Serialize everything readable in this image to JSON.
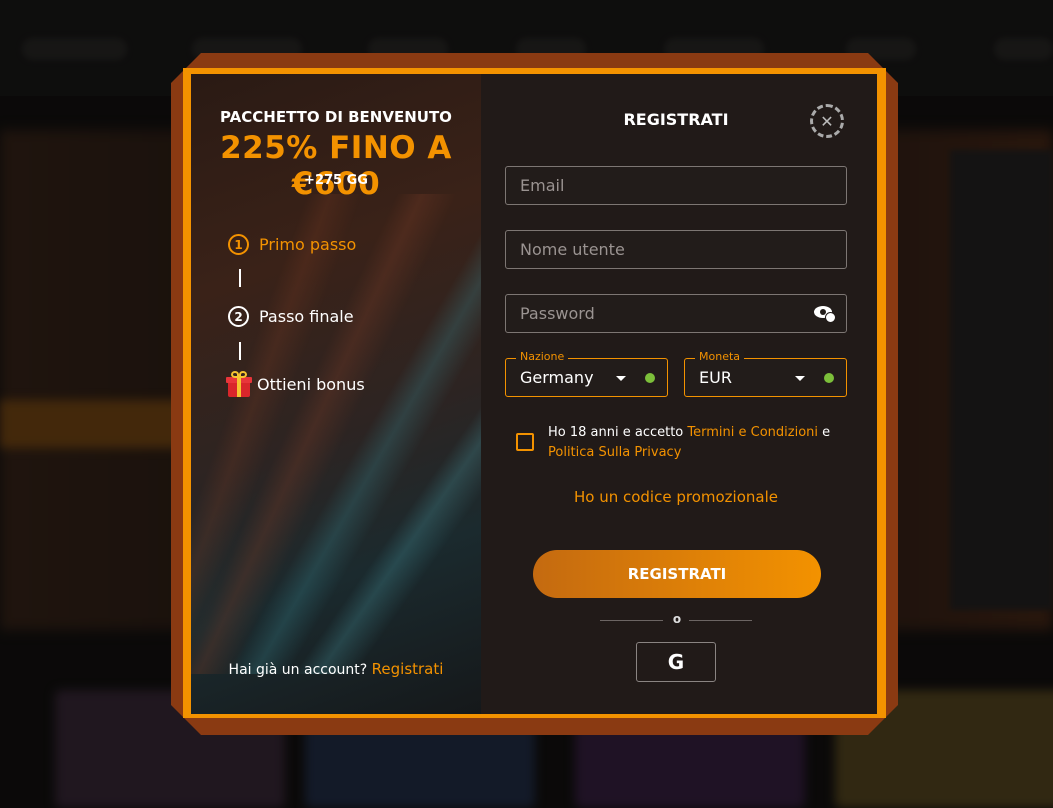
{
  "promo": {
    "subtitle": "PACCHETTO DI BENVENUTO",
    "headline": "225% FINO A €600",
    "extra": "+275 GG",
    "steps": [
      {
        "number": "1",
        "label": "Primo passo"
      },
      {
        "number": "2",
        "label": "Passo finale"
      },
      {
        "label": "Ottieni bonus"
      }
    ],
    "have_account_text": "Hai già un account?",
    "have_account_link": "Registrati"
  },
  "form": {
    "title": "REGISTRATI",
    "close_icon": "close-icon",
    "email_placeholder": "Email",
    "username_placeholder": "Nome utente",
    "password_placeholder": "Password",
    "country": {
      "label": "Nazione",
      "value": "Germany"
    },
    "currency": {
      "label": "Moneta",
      "value": "EUR"
    },
    "terms_prefix": "Ho 18 anni e accetto ",
    "terms_link": "Termini e Condizioni",
    "terms_middle": " e ",
    "privacy_link": "Politica Sulla Privacy",
    "promo_code_link": "Ho un codice promozionale",
    "submit_label": "REGISTRATI",
    "or_label": "o",
    "google_label": "G"
  },
  "colors": {
    "accent": "#f39200",
    "frame": "#8a3a12",
    "panel": "#211a18",
    "valid": "#7cbf3a"
  }
}
